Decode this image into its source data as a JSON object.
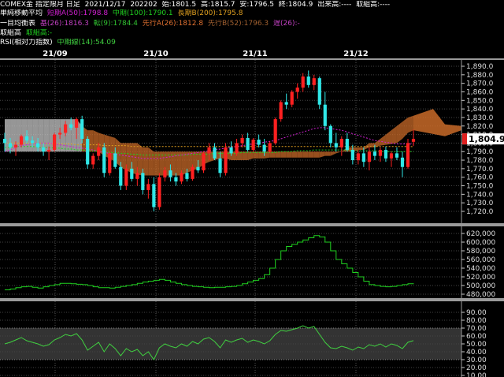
{
  "header": {
    "line1": {
      "symbol": "COMEX金 指定限月 日足",
      "date": "2021/12/17",
      "contract": "202202",
      "open": "始:1801.5",
      "high": "高:1815.7",
      "low": "安:1796.5",
      "close": "終:1804.9",
      "volume": "出来高:----",
      "oi": "取組高:----"
    },
    "line2": {
      "title": "単純移動平均",
      "ma_short": "短期A(50):1798.8",
      "ma_mid": "中期(100):1790.1",
      "ma_long": "長期B(200):1795.8"
    },
    "line3": {
      "title": "一目均衡表",
      "kijun": "基(26):1816.3",
      "tenkan": "転(9):1784.4",
      "senkou_a": "先行A(26):1812.8",
      "senkou_b": "先行B(52):1796.3",
      "chikou": "遅(26):-"
    },
    "line4": {
      "title": "取組高",
      "value": "取組高:-"
    },
    "line5": {
      "title": "RSI(相対力指数)",
      "value": "中期線(14):54.09"
    }
  },
  "dates": [
    "21/09",
    "21/10",
    "21/11",
    "21/12"
  ],
  "price_axis": [
    "1,890.0",
    "1,880.0",
    "1,870.0",
    "1,860.0",
    "1,850.0",
    "1,840.0",
    "1,830.0",
    "1,820.0",
    "1,810.0",
    "1,800.0",
    "1,790.0",
    "1,780.0",
    "1,770.0",
    "1,760.0",
    "1,750.0",
    "1,740.0",
    "1,730.0",
    "1,720.0"
  ],
  "current_price": "1,804.9",
  "oi_axis": [
    "620,000",
    "600,000",
    "580,000",
    "560,000",
    "540,000",
    "520,000",
    "500,000",
    "480,000"
  ],
  "rsi_axis": [
    "90.00",
    "80.00",
    "70.00",
    "60.00",
    "50.00",
    "40.00",
    "30.00",
    "20.00",
    "10.00"
  ],
  "colors": {
    "up": "#ff2020",
    "down": "#30e8e8",
    "cloud": "#c86a28",
    "cloud_alt": "#c8c8c8",
    "ma_short": "#d020d0",
    "ma_mid": "#20d020",
    "ma_long": "#e0a020",
    "oi": "#20d020",
    "rsi": "#40d040"
  },
  "chart_data": {
    "type": "candlestick",
    "ohlc": [
      [
        1805,
        1812,
        1790,
        1800
      ],
      [
        1800,
        1806,
        1788,
        1795
      ],
      [
        1795,
        1802,
        1785,
        1798
      ],
      [
        1798,
        1810,
        1795,
        1808
      ],
      [
        1808,
        1815,
        1800,
        1803
      ],
      [
        1803,
        1808,
        1795,
        1800
      ],
      [
        1800,
        1806,
        1790,
        1795
      ],
      [
        1795,
        1800,
        1785,
        1790
      ],
      [
        1790,
        1796,
        1780,
        1792
      ],
      [
        1792,
        1812,
        1790,
        1810
      ],
      [
        1810,
        1818,
        1805,
        1812
      ],
      [
        1812,
        1826,
        1808,
        1822
      ],
      [
        1822,
        1830,
        1815,
        1818
      ],
      [
        1818,
        1830,
        1805,
        1828
      ],
      [
        1828,
        1832,
        1800,
        1805
      ],
      [
        1805,
        1808,
        1770,
        1775
      ],
      [
        1775,
        1788,
        1770,
        1785
      ],
      [
        1785,
        1800,
        1780,
        1795
      ],
      [
        1795,
        1800,
        1760,
        1765
      ],
      [
        1765,
        1790,
        1762,
        1788
      ],
      [
        1788,
        1795,
        1770,
        1772
      ],
      [
        1772,
        1778,
        1745,
        1750
      ],
      [
        1750,
        1775,
        1745,
        1770
      ],
      [
        1770,
        1778,
        1755,
        1758
      ],
      [
        1758,
        1772,
        1750,
        1765
      ],
      [
        1765,
        1770,
        1740,
        1745
      ],
      [
        1745,
        1758,
        1735,
        1752
      ],
      [
        1752,
        1760,
        1720,
        1725
      ],
      [
        1725,
        1765,
        1722,
        1760
      ],
      [
        1760,
        1772,
        1755,
        1768
      ],
      [
        1768,
        1775,
        1755,
        1760
      ],
      [
        1760,
        1765,
        1750,
        1755
      ],
      [
        1755,
        1768,
        1752,
        1765
      ],
      [
        1765,
        1770,
        1755,
        1758
      ],
      [
        1758,
        1775,
        1756,
        1772
      ],
      [
        1772,
        1780,
        1765,
        1768
      ],
      [
        1768,
        1790,
        1765,
        1788
      ],
      [
        1788,
        1800,
        1780,
        1795
      ],
      [
        1795,
        1800,
        1780,
        1782
      ],
      [
        1782,
        1790,
        1760,
        1765
      ],
      [
        1765,
        1800,
        1762,
        1795
      ],
      [
        1795,
        1802,
        1785,
        1788
      ],
      [
        1788,
        1805,
        1785,
        1800
      ],
      [
        1800,
        1810,
        1795,
        1806
      ],
      [
        1806,
        1812,
        1790,
        1792
      ],
      [
        1792,
        1806,
        1790,
        1804
      ],
      [
        1804,
        1810,
        1795,
        1798
      ],
      [
        1798,
        1805,
        1785,
        1790
      ],
      [
        1790,
        1802,
        1788,
        1800
      ],
      [
        1800,
        1830,
        1798,
        1828
      ],
      [
        1828,
        1850,
        1825,
        1848
      ],
      [
        1848,
        1858,
        1840,
        1845
      ],
      [
        1845,
        1862,
        1842,
        1860
      ],
      [
        1860,
        1870,
        1852,
        1865
      ],
      [
        1865,
        1882,
        1860,
        1878
      ],
      [
        1878,
        1885,
        1865,
        1868
      ],
      [
        1868,
        1880,
        1862,
        1876
      ],
      [
        1876,
        1878,
        1840,
        1845
      ],
      [
        1845,
        1860,
        1815,
        1820
      ],
      [
        1820,
        1822,
        1795,
        1800
      ],
      [
        1800,
        1812,
        1790,
        1795
      ],
      [
        1795,
        1808,
        1785,
        1805
      ],
      [
        1805,
        1812,
        1790,
        1792
      ],
      [
        1792,
        1798,
        1775,
        1780
      ],
      [
        1780,
        1792,
        1775,
        1788
      ],
      [
        1788,
        1795,
        1772,
        1778
      ],
      [
        1778,
        1795,
        1768,
        1790
      ],
      [
        1790,
        1798,
        1780,
        1785
      ],
      [
        1785,
        1795,
        1778,
        1792
      ],
      [
        1792,
        1796,
        1778,
        1782
      ],
      [
        1782,
        1790,
        1772,
        1788
      ],
      [
        1788,
        1795,
        1780,
        1783
      ],
      [
        1783,
        1790,
        1760,
        1772
      ],
      [
        1772,
        1805,
        1770,
        1800
      ],
      [
        1801.5,
        1815.7,
        1796.5,
        1804.9
      ]
    ],
    "ma_short": [
      1790,
      1792,
      1795,
      1797,
      1798,
      1799,
      1800,
      1800,
      1800,
      1799,
      1798,
      1797,
      1796,
      1795,
      1794,
      1793,
      1792,
      1790,
      1789,
      1788,
      1787,
      1786,
      1785,
      1784,
      1783,
      1782,
      1782,
      1782,
      1782,
      1783,
      1784,
      1785,
      1786,
      1787,
      1788,
      1789,
      1790,
      1791,
      1792,
      1793,
      1794,
      1795,
      1796,
      1797,
      1798,
      1799,
      1800,
      1801,
      1802,
      1803,
      1805,
      1807,
      1809,
      1811,
      1813,
      1815,
      1817,
      1818,
      1818,
      1817,
      1816,
      1815,
      1813,
      1811,
      1809,
      1807,
      1805,
      1803,
      1802,
      1801,
      1800,
      1799,
      1799,
      1799,
      1798.8
    ],
    "ma_mid": [
      1795,
      1795,
      1796,
      1796,
      1796,
      1796,
      1795,
      1795,
      1795,
      1794,
      1794,
      1793,
      1793,
      1792,
      1792,
      1791,
      1791,
      1790,
      1790,
      1789,
      1789,
      1788,
      1788,
      1787,
      1787,
      1786,
      1786,
      1786,
      1786,
      1786,
      1786,
      1786,
      1786,
      1786,
      1787,
      1787,
      1787,
      1787,
      1788,
      1788,
      1788,
      1788,
      1788,
      1789,
      1789,
      1789,
      1789,
      1789,
      1789,
      1789,
      1790,
      1790,
      1790,
      1791,
      1791,
      1791,
      1792,
      1792,
      1792,
      1792,
      1792,
      1792,
      1792,
      1791,
      1791,
      1791,
      1791,
      1791,
      1790,
      1790,
      1790,
      1790,
      1790,
      1790,
      1790.1
    ],
    "ma_long": [
      1800,
      1800,
      1800,
      1800,
      1800,
      1800,
      1800,
      1800,
      1799,
      1799,
      1799,
      1799,
      1799,
      1798,
      1798,
      1798,
      1798,
      1798,
      1797,
      1797,
      1797,
      1797,
      1797,
      1796,
      1796,
      1796,
      1796,
      1796,
      1796,
      1796,
      1796,
      1796,
      1796,
      1796,
      1796,
      1796,
      1796,
      1796,
      1796,
      1796,
      1796,
      1796,
      1796,
      1796,
      1796,
      1796,
      1796,
      1796,
      1796,
      1796,
      1796,
      1796,
      1796,
      1796,
      1796,
      1796,
      1796,
      1796,
      1796,
      1796,
      1796,
      1796,
      1796,
      1796,
      1796,
      1796,
      1796,
      1796,
      1796,
      1796,
      1796,
      1796,
      1796,
      1796,
      1795.8
    ],
    "cloud_top": [
      1828,
      1828,
      1828,
      1828,
      1828,
      1828,
      1828,
      1828,
      1828,
      1828,
      1828,
      1828,
      1828,
      1828,
      1820,
      1815,
      1815,
      1812,
      1810,
      1808,
      1806,
      1800,
      1800,
      1800,
      1800,
      1795,
      1795,
      1790,
      1790,
      1790,
      1790,
      1790,
      1790,
      1790,
      1790,
      1790,
      1790,
      1790,
      1790,
      1790,
      1790,
      1790,
      1790,
      1790,
      1790,
      1790,
      1790,
      1790,
      1790,
      1790,
      1790,
      1790,
      1790,
      1790,
      1790,
      1790,
      1790,
      1790,
      1790,
      1790,
      1790,
      1790,
      1795,
      1795,
      1795,
      1795,
      1800,
      1800,
      1805,
      1810,
      1815,
      1820,
      1825,
      1830,
      1832
    ],
    "cloud_bottom": [
      1790,
      1790,
      1790,
      1790,
      1790,
      1790,
      1790,
      1790,
      1790,
      1790,
      1790,
      1790,
      1790,
      1790,
      1790,
      1790,
      1790,
      1790,
      1785,
      1782,
      1778,
      1772,
      1768,
      1765,
      1763,
      1762,
      1762,
      1762,
      1762,
      1762,
      1762,
      1762,
      1762,
      1765,
      1768,
      1770,
      1775,
      1778,
      1780,
      1782,
      1782,
      1780,
      1780,
      1780,
      1780,
      1782,
      1782,
      1782,
      1783,
      1783,
      1783,
      1783,
      1783,
      1783,
      1783,
      1783,
      1783,
      1783,
      1785,
      1785,
      1788,
      1790,
      1790,
      1790,
      1792,
      1792,
      1795,
      1795,
      1797,
      1798,
      1799,
      1800,
      1805,
      1812,
      1815
    ],
    "oi": [
      490000,
      492000,
      495000,
      497000,
      498000,
      496000,
      494000,
      497000,
      500000,
      502000,
      505000,
      505000,
      504000,
      503000,
      502000,
      500000,
      497000,
      495000,
      495000,
      494000,
      496000,
      498000,
      500000,
      502000,
      505000,
      508000,
      510000,
      512000,
      514000,
      512000,
      508000,
      505000,
      502000,
      500000,
      498000,
      497000,
      496000,
      495000,
      496000,
      496000,
      497000,
      498000,
      500000,
      504000,
      508000,
      512000,
      516000,
      525000,
      540000,
      560000,
      580000,
      590000,
      595000,
      600000,
      605000,
      610000,
      615000,
      612000,
      600000,
      580000,
      560000,
      550000,
      540000,
      530000,
      520000,
      510000,
      502000,
      500000,
      498000,
      497000,
      498000,
      500000,
      502000,
      504000,
      505000
    ],
    "rsi": [
      50,
      52,
      55,
      58,
      54,
      52,
      50,
      47,
      49,
      55,
      58,
      62,
      60,
      63,
      55,
      42,
      47,
      52,
      40,
      50,
      44,
      35,
      44,
      40,
      43,
      35,
      40,
      30,
      45,
      50,
      47,
      45,
      50,
      47,
      53,
      50,
      56,
      58,
      53,
      45,
      55,
      52,
      55,
      57,
      52,
      55,
      53,
      50,
      54,
      62,
      67,
      66,
      68,
      70,
      73,
      70,
      72,
      62,
      52,
      45,
      44,
      47,
      45,
      42,
      46,
      44,
      49,
      47,
      50,
      46,
      50,
      48,
      44,
      52,
      54.09
    ]
  }
}
